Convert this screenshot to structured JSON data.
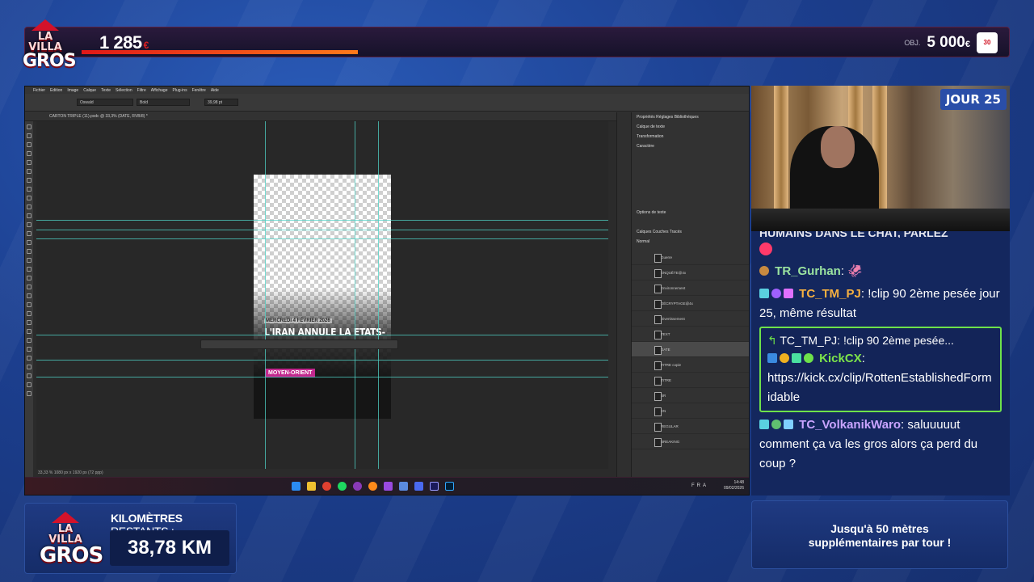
{
  "overlay": {
    "logo_small": "LA VILLA",
    "logo_big": "GROS",
    "counter_value": "1 285",
    "counter_unit": "€",
    "progress_fraction": 0.28,
    "objective_label": "OBJ.",
    "objective_value": "5 000",
    "objective_unit": "€",
    "day_badge": "JOUR 25",
    "km_label_bold": "KILOMÈTRES",
    "km_label_rest": " RESTANTS :",
    "km_value": "38,78 KM",
    "info_line1": "Jusqu'à 50 mètres",
    "info_line2": "supplémentaires par tour !"
  },
  "photoshop": {
    "menu": [
      "Fichier",
      "Edition",
      "Image",
      "Calque",
      "Texte",
      "Sélection",
      "Filtre",
      "Affichage",
      "Plug-ins",
      "Fenêtre",
      "Aide"
    ],
    "font_family": "Oswald",
    "font_style": "Bold",
    "font_size": "39,98 pt",
    "doc_tab": "CARTON TRIPLE (11).psdc @ 33,3% (DATE, RVB/8) *",
    "panel_tabs": "Propriétés   Réglages   Bibliothèques",
    "layer_kind": "Calque de texte",
    "section_transform": "Transformation",
    "section_char": "Caractère",
    "section_options": "Options de texte",
    "layers_tabs": "Calques   Couches   Tracés",
    "blend": "Normal",
    "layers": [
      "Guerre",
      "ENQUÊTE@4x",
      "Environnement",
      "DÉCRYPTAGE@4x",
      "Divertissement",
      "TEXT",
      "DATE",
      "TITRE copie",
      "TITRE",
      "BR",
      "EN",
      "REGULAR",
      "BREAKING"
    ],
    "selected_layer": "DATE",
    "status": "33,33 %   1080 px x 1920 px (72 ppp)",
    "doc_date": "MERCREDI 4 FÉVRIER 2026",
    "doc_headline": "L'IRAN ANNULE LA ETATS-UNIS (AXIOS)",
    "doc_tag": "MOYEN-ORIENT",
    "taskbar_lang": "FRA",
    "taskbar_time": "14:48",
    "taskbar_date": "09/02/2026"
  },
  "chat": {
    "cutoff_line": "HUMAINS DANS LE CHAT, PARLEZ",
    "messages": [
      {
        "user": "TR_Gurhan",
        "color": "#9be3a0",
        "text": ": 🦑"
      },
      {
        "user": "TC_TM_PJ",
        "color": "#f7b040",
        "text": ": !clip 90 2ème pesée jour 25, même résultat"
      }
    ],
    "reply_quote_user": "TC_TM_PJ:",
    "reply_quote_text": "!clip 90 2ème pesée...",
    "reply_user": "KickCX",
    "reply_user_color": "#7ee64a",
    "reply_text": "https://kick.cx/clip/RottenEstablishedFormidable",
    "last_user": "TC_VolkanikWaro",
    "last_user_color": "#c9a4ff",
    "last_text": ": saluuuuut comment ça va les gros alors ça perd du coup ?"
  }
}
